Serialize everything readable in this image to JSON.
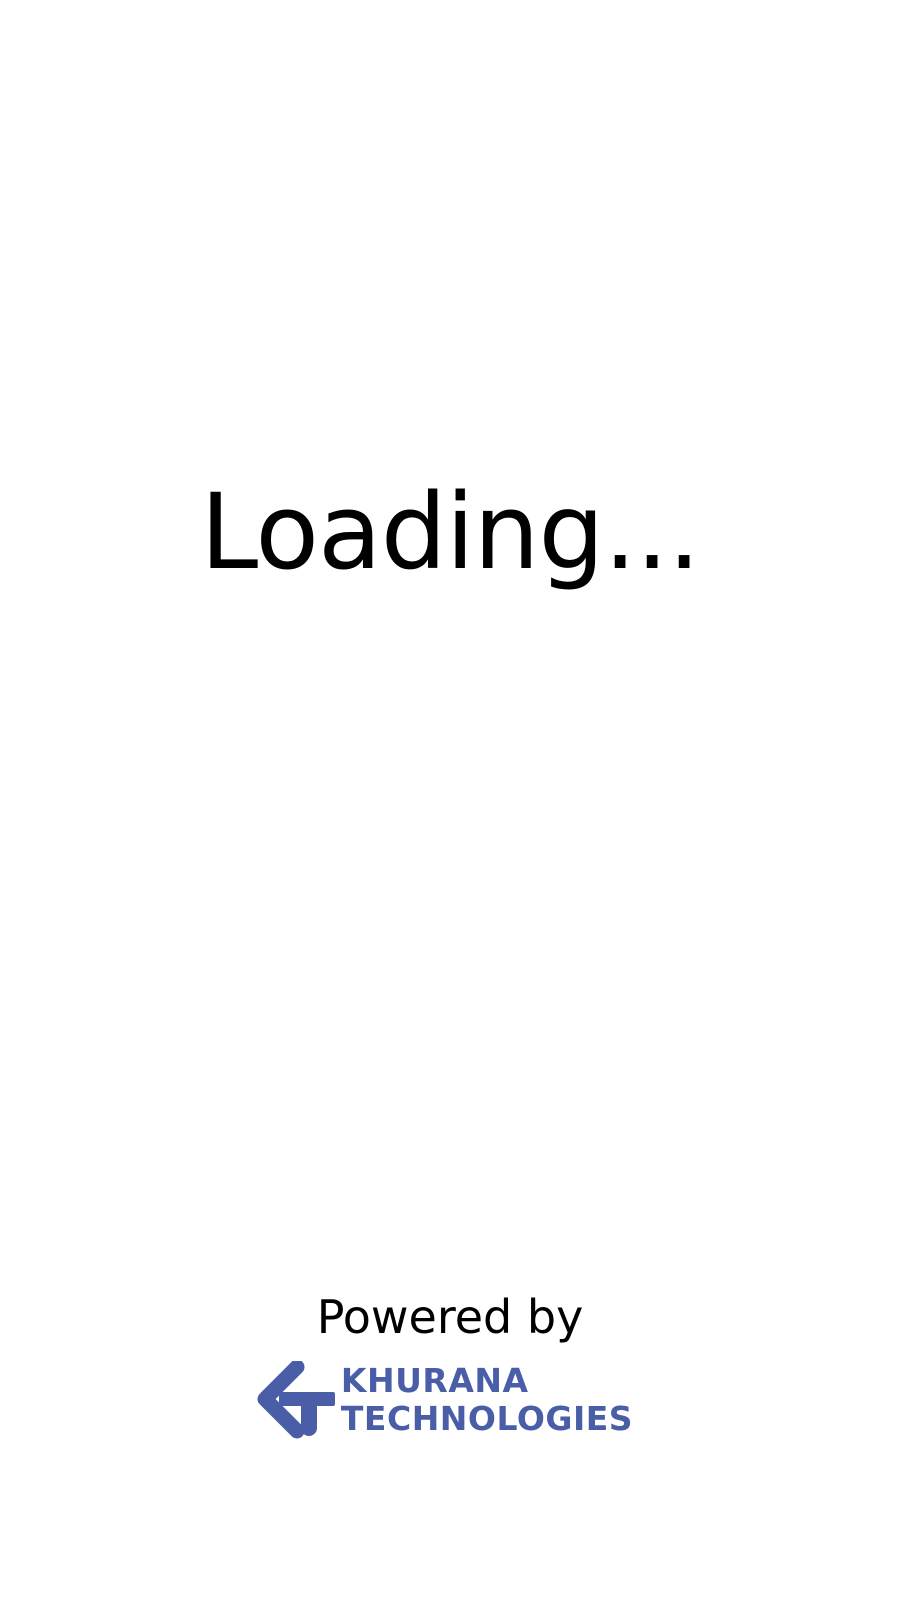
{
  "loading": {
    "text": "Loading..."
  },
  "footer": {
    "powered_by": "Powered by",
    "brand": {
      "line1": "KHURANA",
      "line2": "TECHNOLOGIES",
      "color": "#4a5ea8",
      "logo_icon": "khurana-technologies-logo-icon"
    }
  }
}
